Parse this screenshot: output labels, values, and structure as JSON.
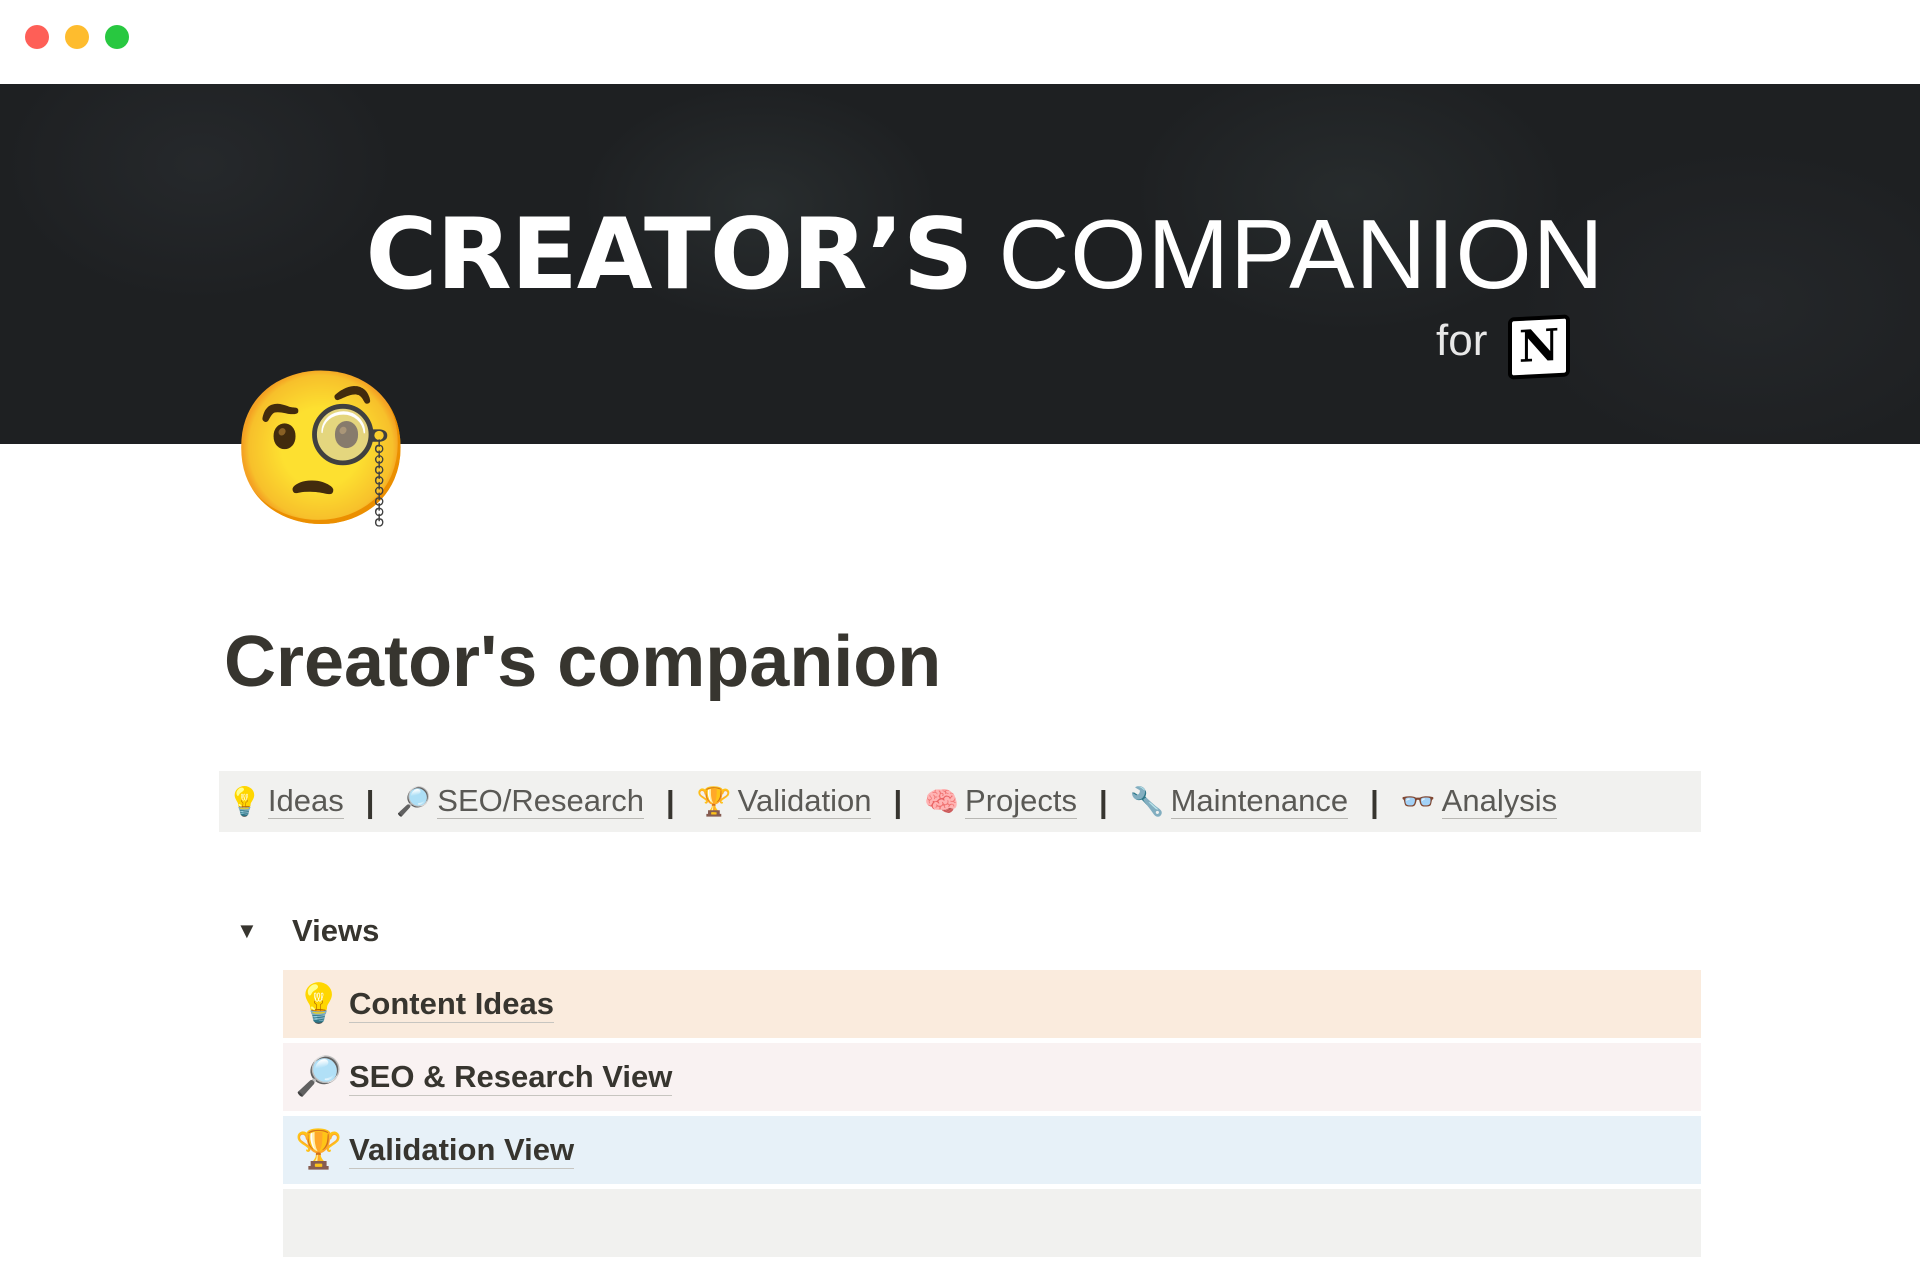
{
  "window": {
    "controls": [
      "close",
      "minimize",
      "zoom"
    ]
  },
  "cover": {
    "title_bold": "CREATOR’S",
    "title_light": "COMPANION",
    "for_text": "for",
    "logo_letter": "N",
    "background_color": "#1e2022"
  },
  "page": {
    "icon": "🧐",
    "title": "Creator's companion"
  },
  "nav": [
    {
      "icon": "💡",
      "label": "Ideas"
    },
    {
      "icon": "🔎",
      "label": "SEO/Research"
    },
    {
      "icon": "🏆",
      "label": "Validation"
    },
    {
      "icon": "🧠",
      "label": "Projects"
    },
    {
      "icon": "🔧",
      "label": "Maintenance"
    },
    {
      "icon": "👓",
      "label": "Analysis"
    }
  ],
  "nav_separator": "|",
  "views": {
    "toggle_arrow": "▼",
    "label": "Views",
    "items": [
      {
        "icon": "💡",
        "label": "Content Ideas",
        "color": "#faebdd"
      },
      {
        "icon": "🔎",
        "label": "SEO & Research View",
        "color": "#f9f2f2"
      },
      {
        "icon": "🏆",
        "label": "Validation View",
        "color": "#e7f1f8"
      }
    ]
  }
}
